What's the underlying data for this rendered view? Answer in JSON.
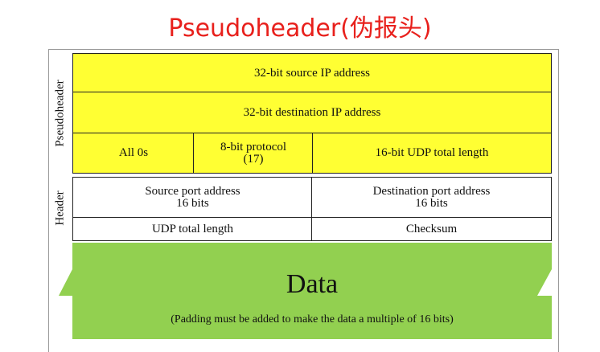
{
  "title": "Pseudoheader(伪报头)",
  "side_labels": {
    "pseudoheader": "Pseudoheader",
    "header": "Header"
  },
  "pseudoheader": {
    "source_ip": "32-bit source IP address",
    "destination_ip": "32-bit destination IP address",
    "zeros": "All 0s",
    "protocol_line1": "8-bit protocol",
    "protocol_line2": "(17)",
    "udp_length": "16-bit UDP total length"
  },
  "header": {
    "source_port_line1": "Source port address",
    "source_port_line2": "16 bits",
    "destination_port_line1": "Destination port address",
    "destination_port_line2": "16 bits",
    "udp_total_length": "UDP total length",
    "checksum": "Checksum"
  },
  "data_block": {
    "label": "Data",
    "note": "(Padding must be added to make the data a multiple of 16 bits)"
  },
  "colors": {
    "title": "#e8201c",
    "pseudoheader_fill": "#ffff33",
    "data_fill": "#92d050"
  }
}
